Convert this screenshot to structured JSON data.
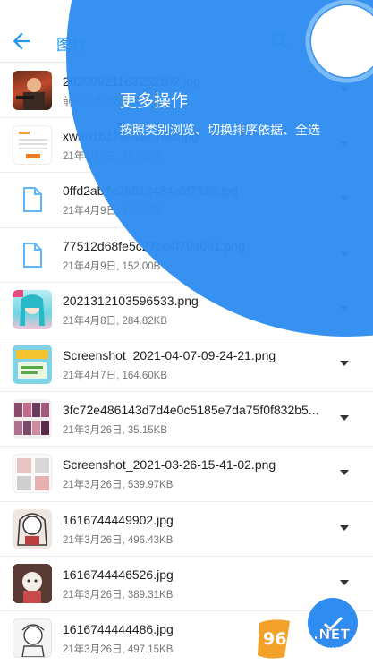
{
  "header": {
    "title": "图片",
    "icons": [
      "back-arrow-icon",
      "search-icon",
      "grid-icon",
      "more-vertical-icon"
    ]
  },
  "files": [
    {
      "name": "20200921163252102.jpg",
      "meta": "前天11点25分",
      "thumb": "game"
    },
    {
      "name": "xwan16179310078l3.jpg",
      "meta": "21年4月9日, 15.55KB",
      "thumb": "form"
    },
    {
      "name": "0ffd2ab7c28512434c6f7529.jpg",
      "meta": "21年4月9日, 152.00B",
      "thumb": "file"
    },
    {
      "name": "77512d68fe5c27cc4f79a0b1.png",
      "meta": "21年4月9日, 152.00B",
      "thumb": "file"
    },
    {
      "name": "2021312103596533.png",
      "meta": "21年4月8日, 284.82KB",
      "thumb": "anime"
    },
    {
      "name": "Screenshot_2021-04-07-09-24-21.png",
      "meta": "21年4月7日, 164.60KB",
      "thumb": "screenshot"
    },
    {
      "name": "3fc72e486143d7d4e0c5185e7da75f0f832b5...",
      "meta": "21年3月26日, 35.15KB",
      "thumb": "collage"
    },
    {
      "name": "Screenshot_2021-03-26-15-41-02.png",
      "meta": "21年3月26日, 539.97KB",
      "thumb": "comic"
    },
    {
      "name": "1616744449902.jpg",
      "meta": "21年3月26日, 496.43KB",
      "thumb": "sketch1"
    },
    {
      "name": "1616744446526.jpg",
      "meta": "21年3月26日, 389.31KB",
      "thumb": "sketch2"
    },
    {
      "name": "1616744444486.jpg",
      "meta": "21年3月26日, 497.15KB",
      "thumb": "sketch3"
    }
  ],
  "overlay": {
    "title": "更多操作",
    "description": "按照类别浏览、切换排序依据、全选"
  },
  "fab": {
    "icon": "check-icon"
  },
  "watermark": {
    "text": "962.NET",
    "subtext": "乐游网"
  },
  "colors": {
    "accent": "#2196f3",
    "overlay": "#2f8cf0",
    "text": "#212121",
    "secondary_text": "#757575"
  }
}
